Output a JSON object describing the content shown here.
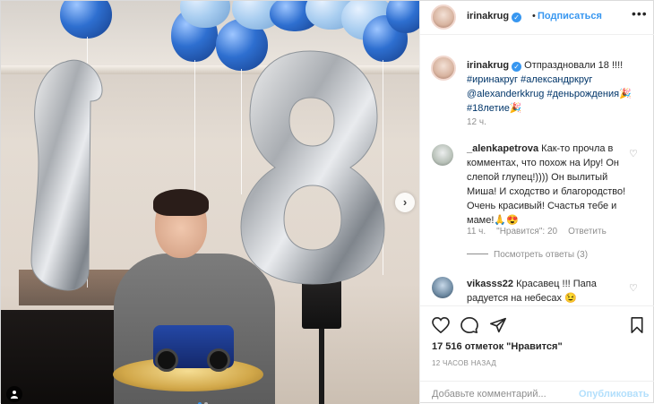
{
  "post": {
    "username": "irinakrug",
    "header_separator": "•",
    "follow_label": "Подписаться",
    "more_label": "•••",
    "caption": {
      "username": "irinakrug",
      "text": " Отпраздновали 18 !!!! ",
      "tags": [
        "#иринакруг",
        "#александркруг",
        "@alexanderkkrug",
        "#деньрождения",
        "#18летие"
      ],
      "emoji": "🎉",
      "time": "12 ч."
    },
    "comments": [
      {
        "username": "_alenkapetrova",
        "text": "Как-то прочла в комментах, что похож на Иру! Он слепой глупец!)))) Он вылитый Миша! И сходство и благородство! Очень красивый! Счастья тебе и маме!🙏😍",
        "time": "11 ч.",
        "likes": "\"Нравится\": 20",
        "reply_label": "Ответить",
        "view_replies": "Посмотреть ответы (3)"
      },
      {
        "username": "vikasss22",
        "text": "Красавец !!! Папа радуется на небесах 😉"
      }
    ],
    "likes_text": "17 516 отметок \"Нравится\"",
    "time_ago": "12 ЧАСОВ НАЗАД",
    "comment_placeholder": "Добавьте комментарий...",
    "publish_label": "Опубликовать",
    "icons": [
      "verified-badge",
      "heart-icon",
      "comment-icon",
      "share-icon",
      "bookmark-icon",
      "chevron-right-icon",
      "user-tag-icon"
    ],
    "colors": {
      "link": "#3897f0",
      "tag": "#003569",
      "muted": "#8e8e8e"
    }
  }
}
